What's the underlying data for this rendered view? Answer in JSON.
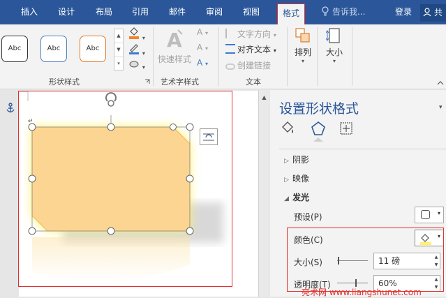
{
  "ribbon_tabs": [
    {
      "label": "插入"
    },
    {
      "label": "设计"
    },
    {
      "label": "布局"
    },
    {
      "label": "引用"
    },
    {
      "label": "邮件"
    },
    {
      "label": "审阅"
    },
    {
      "label": "视图"
    },
    {
      "label": "格式"
    }
  ],
  "tell_me": "告诉我...",
  "login": "登录",
  "share": "共",
  "shape_styles": {
    "gallery": [
      {
        "label": "Abc",
        "border": "#333333"
      },
      {
        "label": "Abc",
        "border": "#4a7ebb"
      },
      {
        "label": "Abc",
        "border": "#e07a28"
      }
    ],
    "group_label": "形状样式"
  },
  "wordart": {
    "quick_styles": "快速样式",
    "group_label": "艺术字样式"
  },
  "text_group": {
    "direction": "文字方向",
    "align": "对齐文本",
    "link": "创建链接",
    "group_label": "文本"
  },
  "arrange": {
    "label": "排列"
  },
  "size": {
    "label": "大小"
  },
  "pane": {
    "title": "设置形状格式",
    "sections": {
      "shadow": "阴影",
      "reflection": "映像",
      "glow": "发光"
    },
    "preset_label": "预设(P)",
    "color_label": "颜色(C)",
    "size_label": "大小(S)",
    "size_value": "11 磅",
    "transparency_label": "透明度(T)",
    "transparency_value": "60%"
  },
  "colors": {
    "accent": "#2b579a",
    "shape_fill": "#fdd592",
    "glow": "#fff36b",
    "highlight": "#e0312e"
  },
  "watermark": "亮术网 www.liangshunet.com"
}
